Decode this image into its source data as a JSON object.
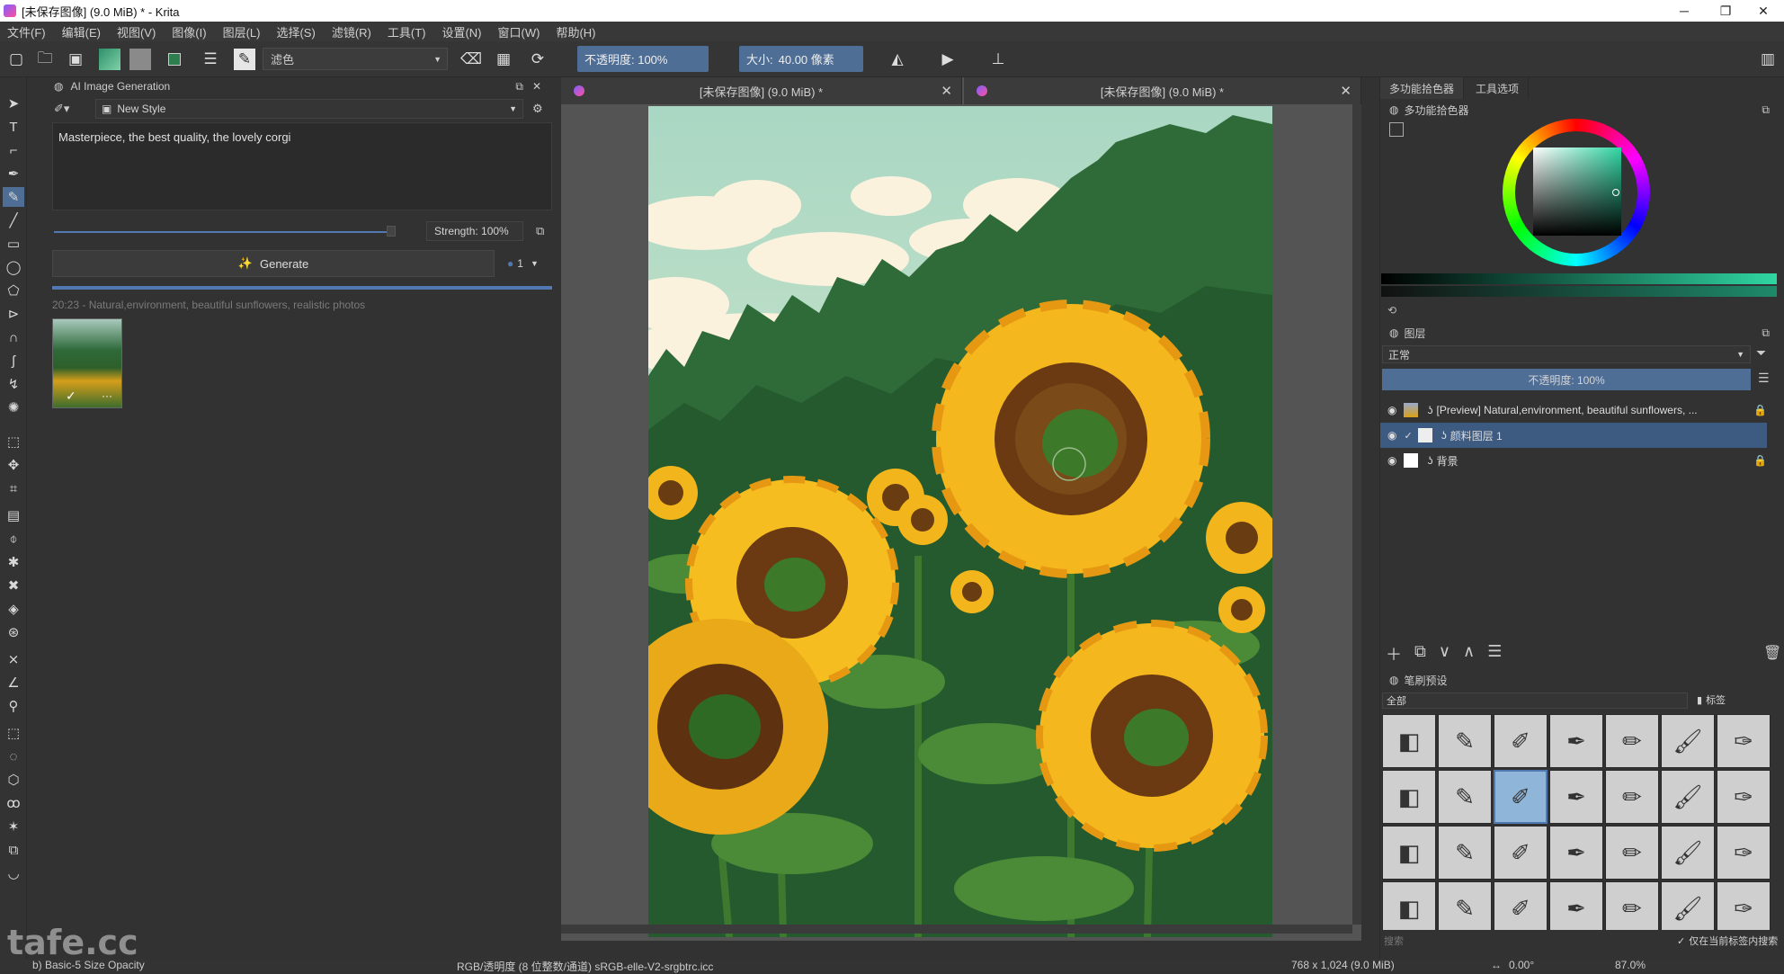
{
  "window": {
    "title": "[未保存图像]  (9.0 MiB) * - Krita",
    "minimize": "─",
    "maximize": "❐",
    "close": "✕"
  },
  "menu": [
    "文件(F)",
    "编辑(E)",
    "视图(V)",
    "图像(I)",
    "图层(L)",
    "选择(S)",
    "滤镜(R)",
    "工具(T)",
    "设置(N)",
    "窗口(W)",
    "帮助(H)"
  ],
  "toolbar": {
    "blend_mode": "滤色",
    "opacity": "不透明度:  100%",
    "size_label": "大小:",
    "size_value": "40.00 像素"
  },
  "ai_docker": {
    "title": "AI Image Generation",
    "style": "New Style",
    "prompt": "Masterpiece, the best quality, the lovely corgi",
    "strength": "Strength: 100%",
    "generate": "Generate",
    "batch_count": "1",
    "progress": 1.0,
    "history_caption": "20:23 - Natural,environment, beautiful sunflowers, realistic photos",
    "thumb_accept": "✓",
    "thumb_more": "···"
  },
  "canvas": {
    "tabs": [
      {
        "label": "[未保存图像]  (9.0 MiB) *",
        "close": "✕"
      },
      {
        "label": "[未保存图像]  (9.0 MiB) *",
        "close": "✕"
      }
    ]
  },
  "right_dock": {
    "tabs": [
      "多功能拾色器",
      "工具选项"
    ],
    "color_panel_title": "多功能拾色器",
    "layers_title": "图层",
    "blend": "正常",
    "opacity": "不透明度:  100%",
    "layers": [
      {
        "name": "[Preview] Natural,environment, beautiful sunflowers, ...",
        "selected": false
      },
      {
        "name": "颜料图层 1",
        "selected": true
      },
      {
        "name": "背景",
        "selected": false
      }
    ],
    "brush_title": "笔刷预设",
    "brush_filter": "全部",
    "brush_tag": "标签",
    "brush_search": "搜索",
    "brush_checkbox": "仅在当前标签内搜索"
  },
  "status": {
    "brush": "b) Basic-5 Size Opacity",
    "color_info": "RGB/透明度 (8 位整数/通道)  sRGB-elle-V2-srgbtrc.icc",
    "image_info": "768 x 1,024 (9.0 MiB)",
    "rotation": "0.00°",
    "zoom": "87.0%"
  },
  "watermark": "tafe.cc",
  "colors": {
    "accent": "#4f6e96",
    "selected_layer": "#3d5a80"
  }
}
